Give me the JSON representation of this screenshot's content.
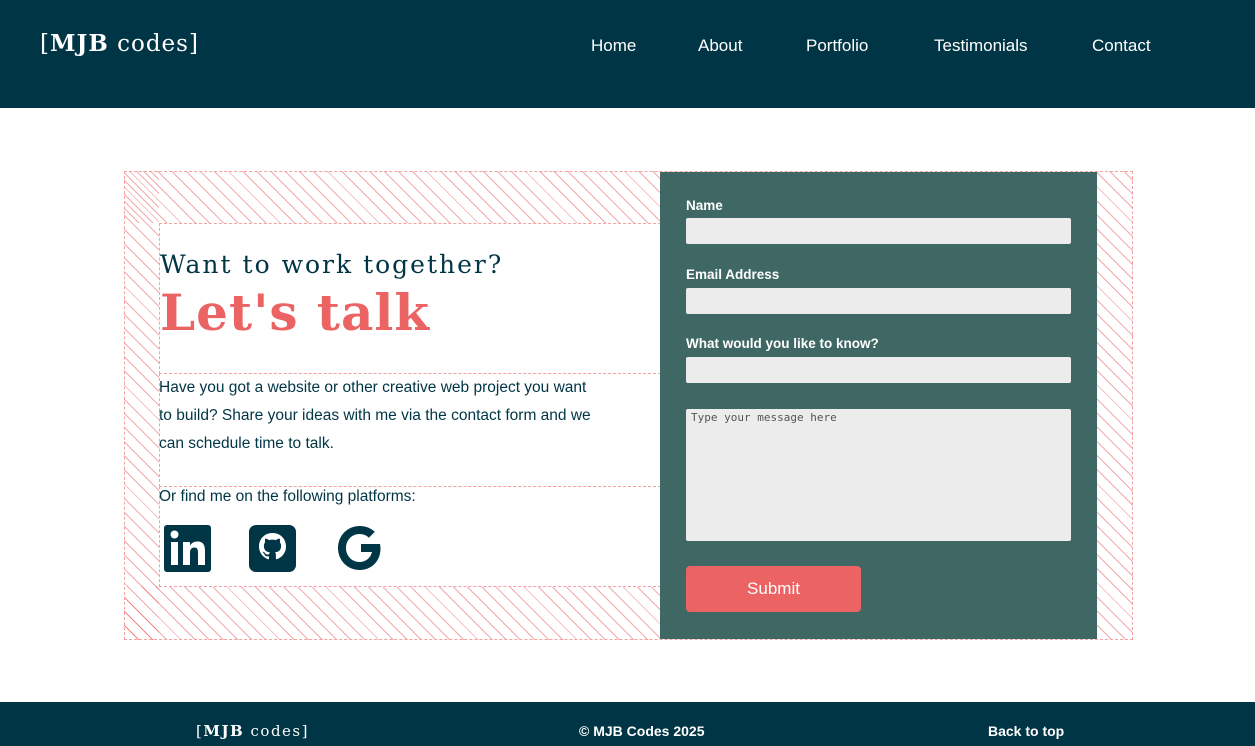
{
  "header": {
    "logo_open": "[",
    "logo_bold": "MJB",
    "logo_rest": " codes",
    "logo_close": "]",
    "nav": [
      "Home",
      "About",
      "Portfolio",
      "Testimonials",
      "Contact"
    ]
  },
  "contact": {
    "subheading": "Want to work together?",
    "heading": "Let's talk",
    "intro": "Have you got a website or other creative web project you want to build? Share your ideas with me via the contact form and we can schedule time to talk.",
    "platforms_label": "Or find me on the following platforms:",
    "social_icons": [
      "linkedin-icon",
      "github-icon",
      "google-icon"
    ]
  },
  "form": {
    "name_label": "Name",
    "name_value": "",
    "email_label": "Email Address",
    "email_value": "",
    "topic_label": "What would you like to know?",
    "topic_value": "",
    "message_placeholder": "Type your message here",
    "submit_label": "Submit"
  },
  "footer": {
    "logo_open": "[",
    "logo_bold": "MJB",
    "logo_rest": " codes",
    "logo_close": "]",
    "copyright": "© MJB Codes 2025",
    "back_to_top": "Back to top"
  },
  "colors": {
    "navy": "#003545",
    "coral": "#ec6363",
    "teal_panel": "#3f6764",
    "input_bg": "#ececec"
  }
}
